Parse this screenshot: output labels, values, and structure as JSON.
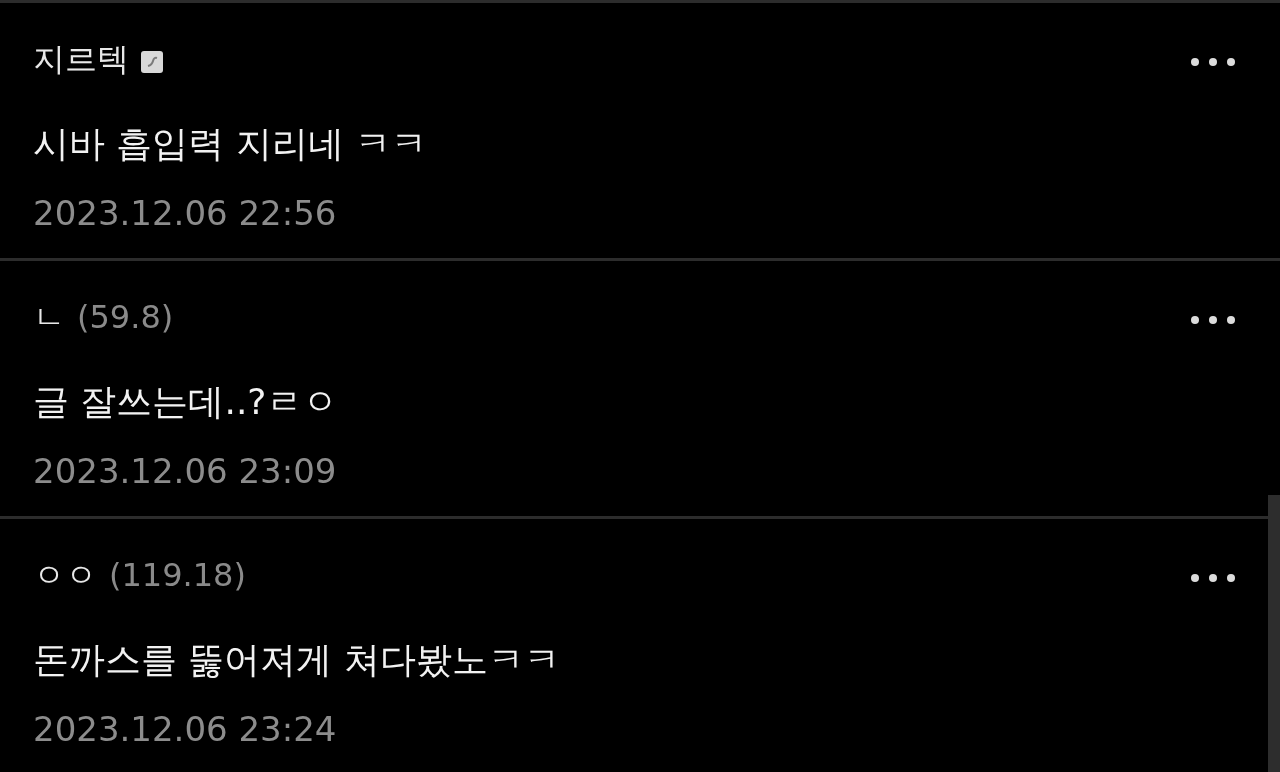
{
  "comments": [
    {
      "author": "지르텍",
      "badge": true,
      "text": "시바 흡입력 지리네 ㅋㅋ",
      "date": "2023.12.06 22:56"
    },
    {
      "author": "ㄴ",
      "ip": "(59.8)",
      "badge": false,
      "text": "글 잘쓰는데..?ㄹㅇ",
      "date": "2023.12.06 23:09"
    },
    {
      "author": "ㅇㅇ",
      "ip": "(119.18)",
      "badge": false,
      "text": "돈까스를 뚫어져게 쳐다봤노ㅋㅋ",
      "date": "2023.12.06 23:24"
    }
  ]
}
